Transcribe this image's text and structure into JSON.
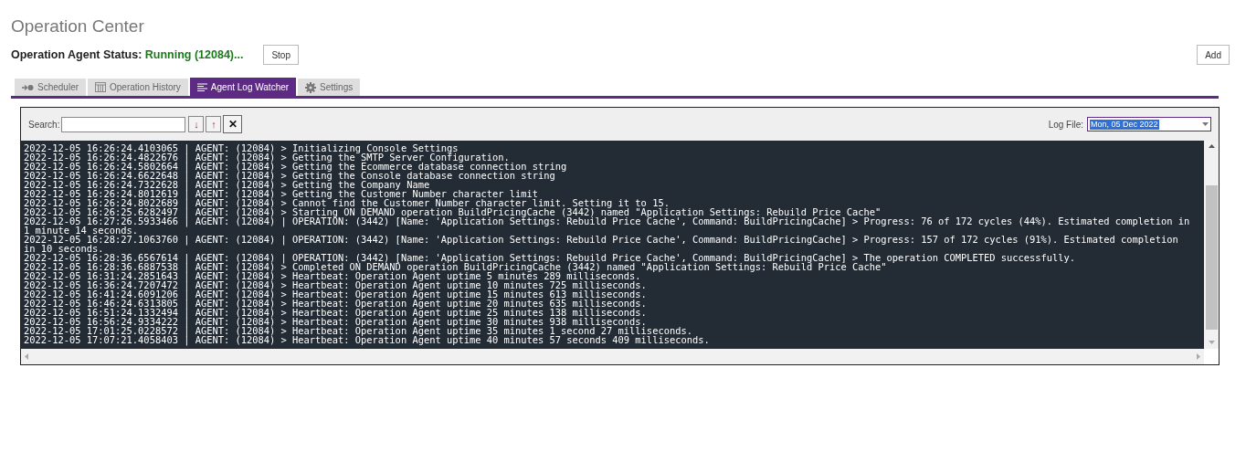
{
  "title": "Operation Center",
  "status": {
    "label": "Operation Agent Status:",
    "value": "Running (12084)...",
    "stop_button": "Stop"
  },
  "add_button": "Add",
  "tabs": [
    {
      "label": "Scheduler",
      "selected": false
    },
    {
      "label": "Operation History",
      "selected": false
    },
    {
      "label": "Agent Log Watcher",
      "selected": true
    },
    {
      "label": "Settings",
      "selected": false
    }
  ],
  "search": {
    "label": "Search:",
    "next": "↓",
    "previous": "↑",
    "clear": "✕"
  },
  "log_file": {
    "label": "Log File:",
    "value": "Mon, 05 Dec 2022"
  },
  "log_lines": [
    "2022-12-05 16:26:24.4103065 | AGENT: (12084) > Initializing Console Settings",
    "2022-12-05 16:26:24.4822676 | AGENT: (12084) > Getting the SMTP Server Configuration.",
    "2022-12-05 16:26:24.5802664 | AGENT: (12084) > Getting the Ecommerce database connection string",
    "2022-12-05 16:26:24.6622648 | AGENT: (12084) > Getting the Console database connection string",
    "2022-12-05 16:26:24.7322628 | AGENT: (12084) > Getting the Company Name",
    "2022-12-05 16:26:24.8012619 | AGENT: (12084) > Getting the Customer Number character limit",
    "2022-12-05 16:26:24.8022689 | AGENT: (12084) > Cannot find the Customer Number character limit. Setting it to 15.",
    "2022-12-05 16:26:25.6282497 | AGENT: (12084) > Starting ON DEMAND operation BuildPricingCache (3442) named \"Application Settings: Rebuild Price Cache\"",
    "2022-12-05 16:27:26.5933466 | AGENT: (12084) | OPERATION: (3442) [Name: 'Application Settings: Rebuild Price Cache', Command: BuildPricingCache] > Progress: 76 of 172 cycles (44%). Estimated completion in 1 minute 14 seconds.",
    "2022-12-05 16:28:27.1063760 | AGENT: (12084) | OPERATION: (3442) [Name: 'Application Settings: Rebuild Price Cache', Command: BuildPricingCache] > Progress: 157 of 172 cycles (91%). Estimated completion in 10 seconds.",
    "2022-12-05 16:28:36.6567614 | AGENT: (12084) | OPERATION: (3442) [Name: 'Application Settings: Rebuild Price Cache', Command: BuildPricingCache] > The operation COMPLETED successfully.",
    "2022-12-05 16:28:36.6887538 | AGENT: (12084) > Completed ON DEMAND operation BuildPricingCache (3442) named \"Application Settings: Rebuild Price Cache\"",
    "2022-12-05 16:31:24.2851643 | AGENT: (12084) > Heartbeat: Operation Agent uptime 5 minutes 289 milliseconds.",
    "2022-12-05 16:36:24.7207472 | AGENT: (12084) > Heartbeat: Operation Agent uptime 10 minutes 725 milliseconds.",
    "2022-12-05 16:41:24.6091206 | AGENT: (12084) > Heartbeat: Operation Agent uptime 15 minutes 613 milliseconds.",
    "2022-12-05 16:46:24.6313805 | AGENT: (12084) > Heartbeat: Operation Agent uptime 20 minutes 635 milliseconds.",
    "2022-12-05 16:51:24.1332494 | AGENT: (12084) > Heartbeat: Operation Agent uptime 25 minutes 138 milliseconds.",
    "2022-12-05 16:56:24.9334222 | AGENT: (12084) > Heartbeat: Operation Agent uptime 30 minutes 938 milliseconds.",
    "2022-12-05 17:01:25.0228572 | AGENT: (12084) > Heartbeat: Operation Agent uptime 35 minutes 1 second 27 milliseconds.",
    "2022-12-05 17:07:21.4058403 | AGENT: (12084) > Heartbeat: Operation Agent uptime 40 minutes 57 seconds 409 milliseconds."
  ]
}
